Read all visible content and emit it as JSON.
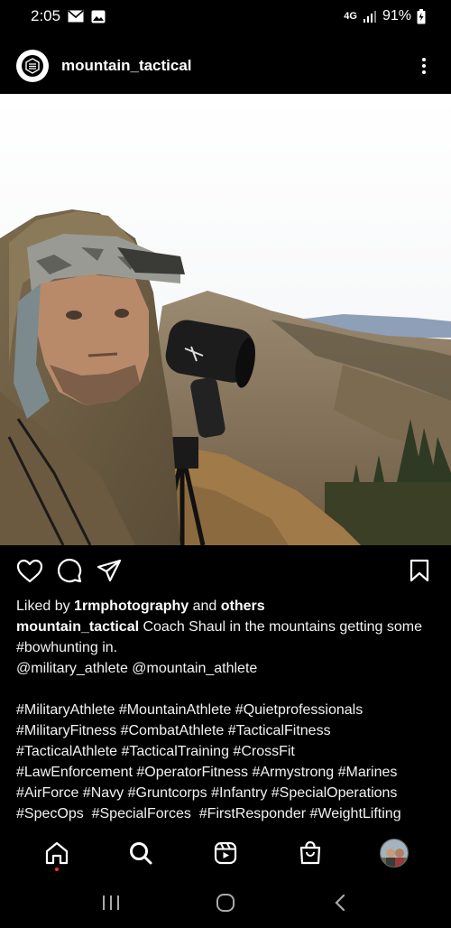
{
  "status_bar": {
    "time": "2:05",
    "network": "4G",
    "battery": "91%",
    "icons": [
      "mail-icon",
      "image-icon",
      "signal-icon",
      "battery-icon"
    ]
  },
  "post": {
    "username": "mountain_tactical",
    "liked_by_prefix": "Liked by ",
    "liked_by_user": "1rmphotography",
    "liked_by_middle": " and ",
    "liked_by_suffix": "others",
    "caption_author": "mountain_tactical",
    "caption_text": " Coach Shaul in the mountains getting some #bowhunting in.",
    "mentions": "@military_athlete @mountain_athlete",
    "hashtags": [
      "#MilitaryAthlete #MountainAthlete #Quietprofessionals",
      "#MilitaryFitness #CombatAthlete #TacticalFitness",
      "#TacticalAthlete #TacticalTraining #CrossFit",
      "#LawEnforcement #OperatorFitness #Armystrong #Marines",
      "#AirForce #Navy #Gruntcorps #Infantry #SpecialOperations",
      "#SpecOps  #SpecialForces  #FirstResponder #WeightLifting"
    ]
  },
  "actions": [
    "heart-icon",
    "comment-icon",
    "share-icon",
    "bookmark-icon"
  ],
  "bottom_nav": [
    "home-icon",
    "search-icon",
    "reels-icon",
    "shop-icon",
    "profile-avatar"
  ],
  "system_nav": [
    "recents-icon",
    "home-button-icon",
    "back-icon"
  ]
}
